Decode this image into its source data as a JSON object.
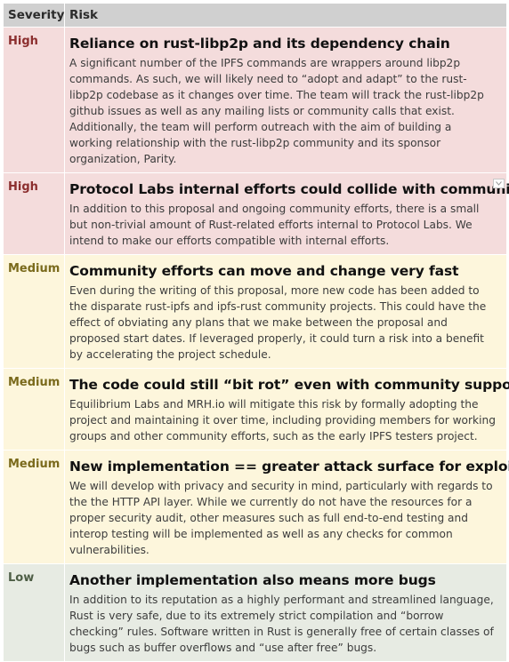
{
  "header": {
    "severity_label": "Severity",
    "risk_label": "Risk"
  },
  "rows": [
    {
      "severity": "High",
      "title": "Reliance on rust-libp2p and its dependency chain",
      "description": "A significant number of the IPFS commands are wrappers around libp2p commands. As such, we will likely need to “adopt and adapt” to the rust-libp2p codebase as it changes over time. The team will track the rust-libp2p github issues as well as any mailing lists or community calls that exist. Additionally, the team will perform outreach with the aim of building a working relationship with the rust-libp2p community and its sponsor organization, Parity."
    },
    {
      "severity": "High",
      "title": "Protocol Labs internal efforts could collide with community",
      "description": "In addition to this proposal and ongoing community efforts, there is a small but non-trivial amount of Rust-related efforts internal to Protocol Labs. We intend to make our efforts compatible with internal efforts."
    },
    {
      "severity": "Medium",
      "title": "Community efforts can move and change very fast",
      "description": "Even during the writing of this proposal, more new code has been added to the disparate rust-ipfs and ipfs-rust community projects. This could have the effect of obviating any plans that we make between the proposal and proposed start dates. If leveraged properly, it could turn a risk into a benefit by accelerating the project schedule."
    },
    {
      "severity": "Medium",
      "title": "The code could still “bit rot” even with community support",
      "description": "Equilibrium Labs and MRH.io will mitigate this risk by formally adopting the project and maintaining it over time, including providing members for working groups and other community efforts, such as the early IPFS testers project."
    },
    {
      "severity": "Medium",
      "title": "New implementation == greater attack surface for exploits",
      "description": "We will develop with privacy and security in mind, particularly with regards to the the HTTP API layer. While we currently do not have the resources for a proper security audit, other measures such as full end-to-end testing and interop testing will be implemented as well as any checks for common vulnerabilities."
    },
    {
      "severity": "Low",
      "title": "Another implementation also means more bugs",
      "description": "In addition to its reputation as a highly performant and streamlined language, Rust is very safe, due to its extremely strict compilation and “borrow checking” rules. Software written in Rust is generally free of certain classes of bugs such as buffer overflows and “use after free” bugs."
    }
  ],
  "colors": {
    "header_bg": "#d0d0d0",
    "high_bg": "#f4dcdc",
    "high_text": "#8b2e2e",
    "medium_bg": "#fdf6dc",
    "medium_text": "#7a6a1c",
    "low_bg": "#e7ebe3",
    "low_text": "#4e5e46"
  },
  "icons": {
    "row_menu": "chevron-down-icon"
  }
}
